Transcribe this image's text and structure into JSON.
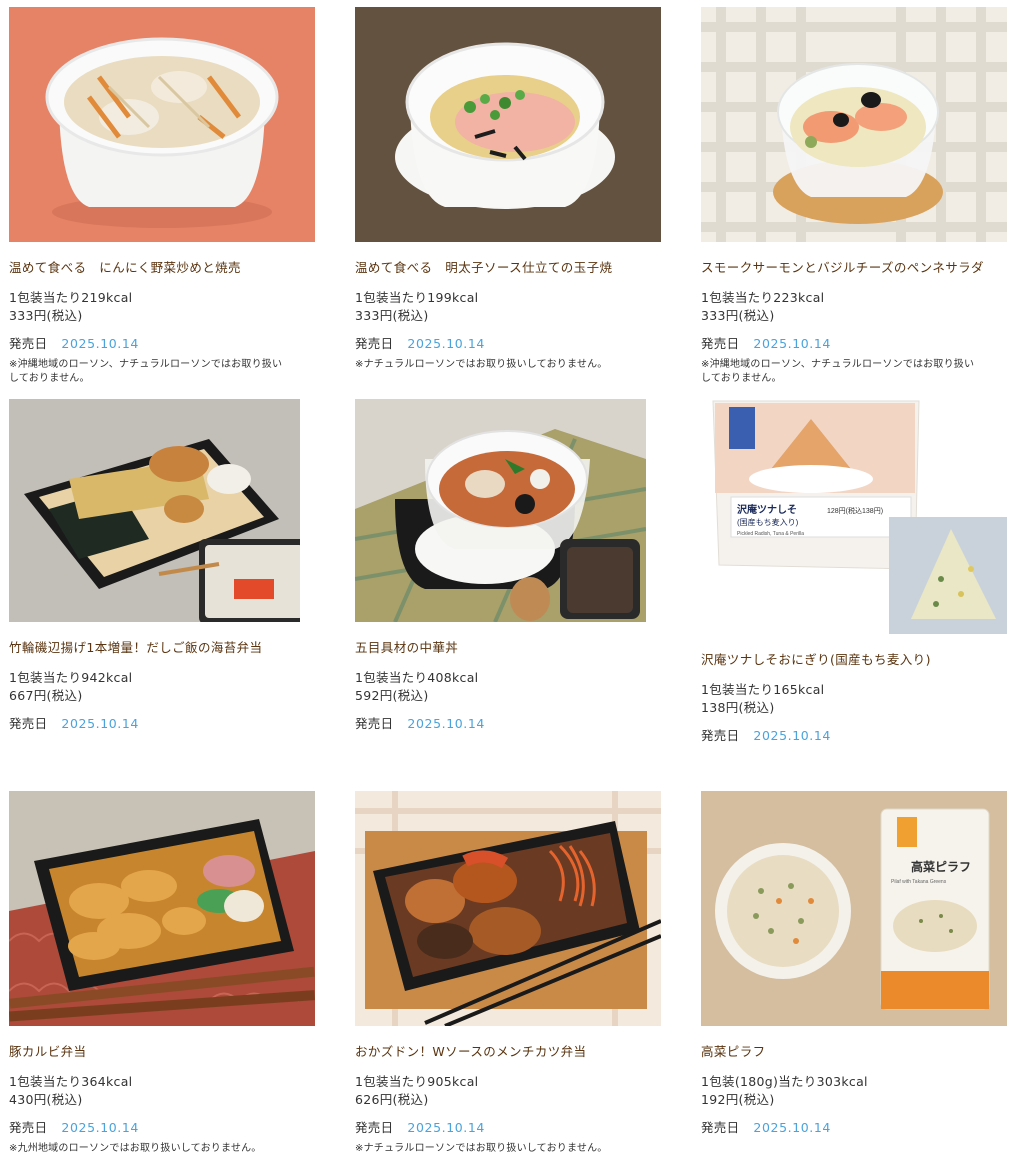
{
  "labels": {
    "release": "発売日"
  },
  "products": [
    {
      "title": "温めて食べる　にんにく野菜炒めと焼売",
      "kcal": "1包装当たり219kcal",
      "price": "333円(税込)",
      "date": "2025.10.14",
      "note": "※沖縄地域のローソン、ナチュラルローソンではお取り扱い\nしておりません。"
    },
    {
      "title": "温めて食べる　明太子ソース仕立ての玉子焼",
      "kcal": "1包装当たり199kcal",
      "price": "333円(税込)",
      "date": "2025.10.14",
      "note": "※ナチュラルローソンではお取り扱いしておりません。"
    },
    {
      "title": "スモークサーモンとバジルチーズのペンネサラダ",
      "kcal": "1包装当たり223kcal",
      "price": "333円(税込)",
      "date": "2025.10.14",
      "note": "※沖縄地域のローソン、ナチュラルローソンではお取り扱い\nしておりません。"
    },
    {
      "title": "竹輪磯辺揚げ1本増量！だしご飯の海苔弁当",
      "kcal": "1包装当たり942kcal",
      "price": "667円(税込)",
      "date": "2025.10.14"
    },
    {
      "title": "五目具材の中華丼",
      "kcal": "1包装当たり408kcal",
      "price": "592円(税込)",
      "date": "2025.10.14"
    },
    {
      "title": "沢庵ツナしそおにぎり(国産もち麦入り)",
      "kcal": "1包装当たり165kcal",
      "price": "138円(税込)",
      "date": "2025.10.14",
      "package_text": "沢庵ツナしそ",
      "package_sub": "(国産もち麦入り)",
      "package_en": "Pickled Radish, Tuna & Perilla",
      "package_kcal": "128円(税込138円)"
    },
    {
      "title": "豚カルビ弁当",
      "kcal": "1包装当たり364kcal",
      "price": "430円(税込)",
      "date": "2025.10.14",
      "note": "※九州地域のローソンではお取り扱いしておりません。"
    },
    {
      "title": "おかズドン！Wソースのメンチカツ弁当",
      "kcal": "1包装当たり905kcal",
      "price": "626円(税込)",
      "date": "2025.10.14",
      "note": "※ナチュラルローソンではお取り扱いしておりません。"
    },
    {
      "title": "高菜ピラフ",
      "kcal": "1包装(180g)当たり303kcal",
      "price": "192円(税込)",
      "date": "2025.10.14",
      "package_text": "高菜ピラフ",
      "package_en": "Pilaf with Takana Greens"
    }
  ],
  "colors": {
    "title": "#5a3410",
    "date": "#4aa3dc",
    "text": "#333333"
  }
}
